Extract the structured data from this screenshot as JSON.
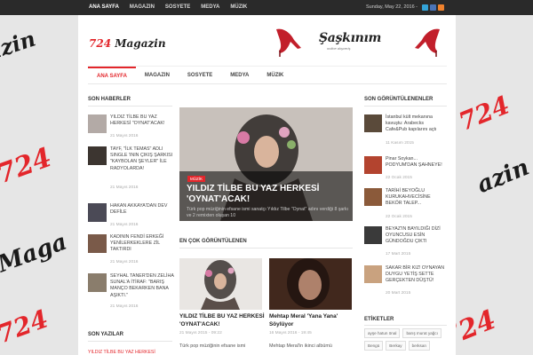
{
  "top_nav": {
    "items": [
      "ANA SAYFA",
      "MAGAZIN",
      "SOSYETE",
      "MEDYA",
      "MÜZIK"
    ],
    "active_index": 0,
    "date": "Sunday, May 22, 2016 -"
  },
  "social_icons": [
    {
      "name": "twitter-icon",
      "color": "#33a3d8"
    },
    {
      "name": "facebook-icon",
      "color": "#4a74b8"
    },
    {
      "name": "rss-icon",
      "color": "#f0822d"
    }
  ],
  "header": {
    "logo_number": "724",
    "logo_word": "Magazin",
    "ad_brand": "Şaşkınım",
    "ad_tagline": "online alışveriş"
  },
  "main_nav": {
    "items": [
      "ANA SAYFA",
      "MAGAZIN",
      "SOSYETE",
      "MEDYA",
      "MÜZIK"
    ],
    "active_index": 0
  },
  "left_sidebar": {
    "title": "SON HABERLER",
    "items": [
      {
        "title": "YILDIZ TİLBE BU YAZ HERKESİ \"OYNAT'ACAK!",
        "date": "21 Mayıs 2016",
        "color": "#b3aaa6"
      },
      {
        "title": "TAYF, \"İLK TEMAS\" ADLI SINGLE 'ININ ÇIKIŞ ŞARKISI \"KAYBOLAN ŞEYLER\" İLE RADYOLARDA!",
        "date": "21 Mayıs 2016",
        "color": "#3c3530"
      },
      {
        "title": "HAKAN AKKAYA'DAN DEV DEFİLE",
        "date": "21 Mayıs 2016",
        "color": "#4b4a56"
      },
      {
        "title": "KADININ FENDİ ERKEĞİ YENİLERKEKLERE ZİL TAKTIRDI",
        "date": "21 Mayıs 2016",
        "color": "#7a5a49"
      },
      {
        "title": "SEYHAL TANER'DEN ZELİHA SUNAL'A İTİRAF: \"BARIŞ MANÇO BEKARKEN BANA AŞIKTI.\"",
        "date": "21 Mayıs 2016",
        "color": "#8a7d6c"
      }
    ],
    "second_title": "SON YAZILAR",
    "second_item": "YILDIZ TİLBE BU YAZ HERKESİ"
  },
  "featured": {
    "category": "MÜZİK",
    "title": "YILDIZ TİLBE BU YAZ HERKESİ 'OYNAT'ACAK!",
    "excerpt": "Türk pop müziğinin efsane ismi sanatçı Yıldız Tilbe \"Oynat\" adını verdiği 8 şarkı ve 2 remixten oluşan 10"
  },
  "most_viewed": {
    "title": "EN ÇOK GÖRÜNTÜLENEN",
    "cards": [
      {
        "title": "YILDIZ TİLBE BU YAZ HERKESİ 'OYNAT'ACAK!",
        "date": "21 Mayıs 2015 - 09:22",
        "excerpt": "Türk pop müziğinin efsane ismi"
      },
      {
        "title": "Mehtap Meral 'Yana Yana' Söylüyor",
        "date": "16 Mayıs 2016 - 19:45",
        "excerpt": "Mehtap Meral'in ikinci albümü"
      }
    ]
  },
  "right_sidebar": {
    "title": "SON GÖRÜNTÜLENENLER",
    "items": [
      {
        "title": "İstanbul kült mekanına kavuştu: Arabecks Cafe&Pub kapılarını açtı",
        "date": "11 Kasım 2015",
        "color": "#5a4a3a"
      },
      {
        "title": "Pinar Soykan... PODYUM'DAN ŞAHNEYE!",
        "date": "22 Ocak 2015",
        "color": "#b3442f"
      },
      {
        "title": "TARİHİ BEYOĞLU KURUKAHVECİSİNE BEKÖR TALEP...",
        "date": "22 Ocak 2015",
        "color": "#8b5a3a"
      },
      {
        "title": "BEYAZ'IN BAYILDIĞI DİZİ OYUNCUSU ESİN GÜNDOĞDU ÇIKTI",
        "date": "17 Mart 2015",
        "color": "#3a3a3a"
      },
      {
        "title": "SAKAR BİR KIZ! OYNAYAN DUYGU YETİŞ SETTE GERÇEKTEN DÜŞTÜ!",
        "date": "20 Mart 2015",
        "color": "#c9a27f"
      }
    ],
    "tags_title": "ETİKETLER",
    "tags": [
      "ayşe hatun önal",
      "barış murat yağcı",
      "Bengü",
      "Berkay",
      "berksan"
    ]
  }
}
